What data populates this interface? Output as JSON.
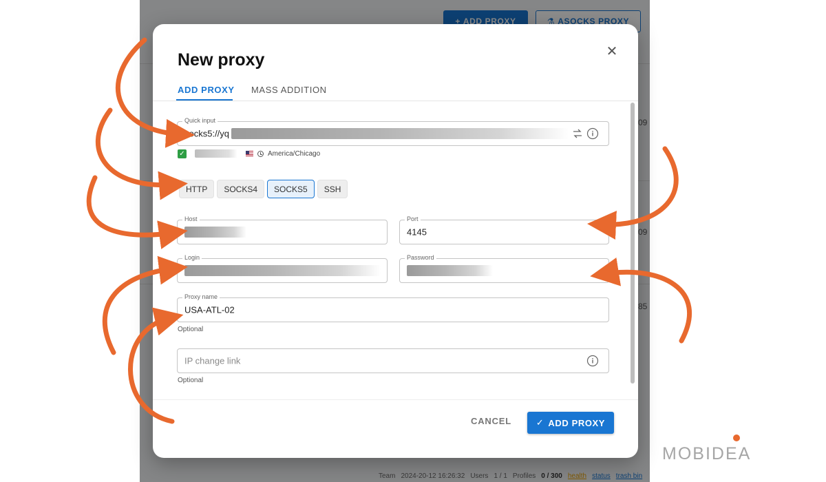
{
  "background": {
    "add_proxy_label": "ADD PROXY",
    "asocks_label": "ASOCKS PROXY",
    "row_digits": [
      "09",
      "09",
      "85"
    ],
    "footer": {
      "team": "Team",
      "timestamp": "2024-20-12 16:26:32",
      "users_label": "Users",
      "users_value": "1 / 1",
      "profiles_label": "Profiles",
      "profiles_value": "0 / 300",
      "health": "health",
      "status": "status",
      "trash": "trash bin"
    }
  },
  "modal": {
    "title": "New proxy",
    "tabs": [
      {
        "label": "ADD PROXY",
        "active": true
      },
      {
        "label": "MASS ADDITION",
        "active": false
      }
    ],
    "quick_input": {
      "label": "Quick input",
      "value": "socks5://yq"
    },
    "status": {
      "timezone": "America/Chicago"
    },
    "protocols": [
      {
        "label": "HTTP",
        "active": false
      },
      {
        "label": "SOCKS4",
        "active": false
      },
      {
        "label": "SOCKS5",
        "active": true
      },
      {
        "label": "SSH",
        "active": false
      }
    ],
    "host": {
      "label": "Host"
    },
    "port": {
      "label": "Port",
      "value": "4145"
    },
    "login": {
      "label": "Login"
    },
    "password": {
      "label": "Password"
    },
    "proxy_name": {
      "label": "Proxy name",
      "value": "USA-ATL-02",
      "helper": "Optional"
    },
    "ip_change": {
      "placeholder": "IP change link",
      "helper": "Optional"
    },
    "cancel_label": "CANCEL",
    "submit_label": "ADD PROXY"
  },
  "brand": {
    "logo_text": "MOBIDEA",
    "arrow_color": "#e8692e",
    "accent": "#1976d2"
  }
}
